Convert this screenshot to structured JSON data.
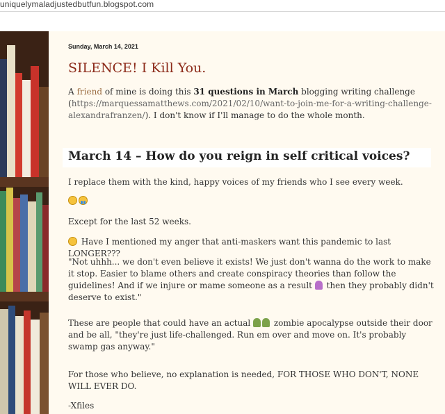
{
  "browser": {
    "url": "uniquelymaladjustedbutfun.blogspot.com"
  },
  "post": {
    "date": "Sunday, March 14, 2021",
    "title": "SILENCE! I Kill You.",
    "intro": {
      "p1": "A ",
      "friend_link": "friend",
      "p2": " of mine is doing this ",
      "bold": "31 questions in March",
      "p3": " blogging writing challenge (",
      "url": "https://marquessamatthews.com/2021/02/10/want-to-join-me-for-a-writing-challenge-alexandrafranzen/",
      "p4": "). I don't know if I'll manage to do the whole month."
    },
    "heading": "March 14 – How do you reign in self critical voices?",
    "para_replace": "I replace them with the kind, happy voices of my friends who I see every week.",
    "para_except": "Except for the last 52 weeks.",
    "para_anger": "Have I mentioned my anger that anti-maskers want this pandemic to last LONGER???",
    "quote_a": "\"Not uhhh... we don't even believe it exists! We just don't wanna do the work to make it stop. Easier to blame others and create conspiracy theories than follow the guidelines! And if we injure or mame someone as a result ",
    "quote_b": " then they probably didn't deserve to exist.\"",
    "zombie_a": "These are people that could have an actual ",
    "zombie_b": " zombie apocalypse outside their door and be all, \"they're just life-challenged. Run em over and move on. It's probably swamp gas anyway.\"",
    "believe": "For those who believe, no explanation is needed, FOR THOSE WHO DON'T, NONE WILL EVER DO.",
    "signoff": "-Xfiles"
  },
  "icons": [
    "confused-face-icon",
    "crying-face-icon",
    "grimacing-face-icon",
    "person-icon",
    "zombie-icon"
  ],
  "colors": {
    "title": "#8c2a19",
    "link": "#9a6b3f",
    "background": "#fffaf0"
  }
}
